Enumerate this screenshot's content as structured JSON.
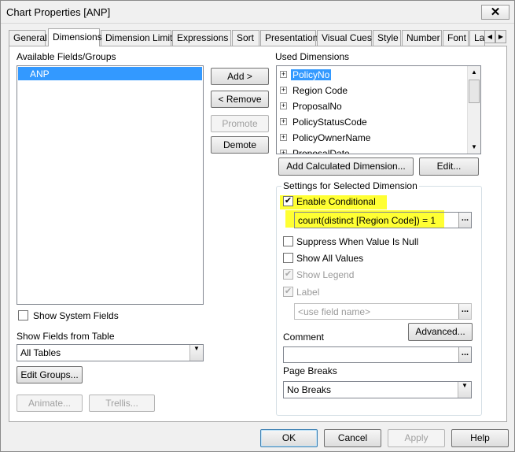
{
  "window": {
    "title": "Chart Properties [ANP]",
    "close_glyph": "✕"
  },
  "tabs": [
    "General",
    "Dimensions",
    "Dimension Limits",
    "Expressions",
    "Sort",
    "Presentation",
    "Visual Cues",
    "Style",
    "Number",
    "Font",
    "La"
  ],
  "active_tab": "Dimensions",
  "available": {
    "label": "Available Fields/Groups",
    "items": [
      "ANP"
    ],
    "show_system_fields_label": "Show System Fields",
    "show_system_fields_checked": false,
    "show_fields_from_table_label": "Show Fields from Table",
    "table_value": "All Tables",
    "edit_groups_label": "Edit Groups...",
    "animate_label": "Animate...",
    "trellis_label": "Trellis..."
  },
  "middle_buttons": {
    "add": "Add >",
    "remove": "< Remove",
    "promote": "Promote",
    "demote": "Demote"
  },
  "used": {
    "label": "Used Dimensions",
    "items": [
      "PolicyNo",
      "Region Code",
      "ProposalNo",
      "PolicyStatusCode",
      "PolicyOwnerName",
      "ProposalDate"
    ],
    "selected": "PolicyNo",
    "add_calculated_label": "Add Calculated Dimension...",
    "edit_label": "Edit..."
  },
  "settings": {
    "group_label": "Settings for Selected Dimension",
    "enable_conditional_label": "Enable Conditional",
    "enable_conditional_checked": true,
    "condition_expression": "count(distinct  [Region Code]) = 1",
    "suppress_null_label": "Suppress When Value Is Null",
    "show_all_values_label": "Show All Values",
    "show_legend_label": "Show Legend",
    "label_label": "Label",
    "label_placeholder": "<use field name>",
    "advanced_label": "Advanced...",
    "comment_label": "Comment",
    "page_breaks_label": "Page Breaks",
    "page_breaks_value": "No Breaks"
  },
  "footer": {
    "ok": "OK",
    "cancel": "Cancel",
    "apply": "Apply",
    "help": "Help"
  },
  "colors": {
    "highlight": "#ffff33",
    "selection": "#3399ff"
  }
}
